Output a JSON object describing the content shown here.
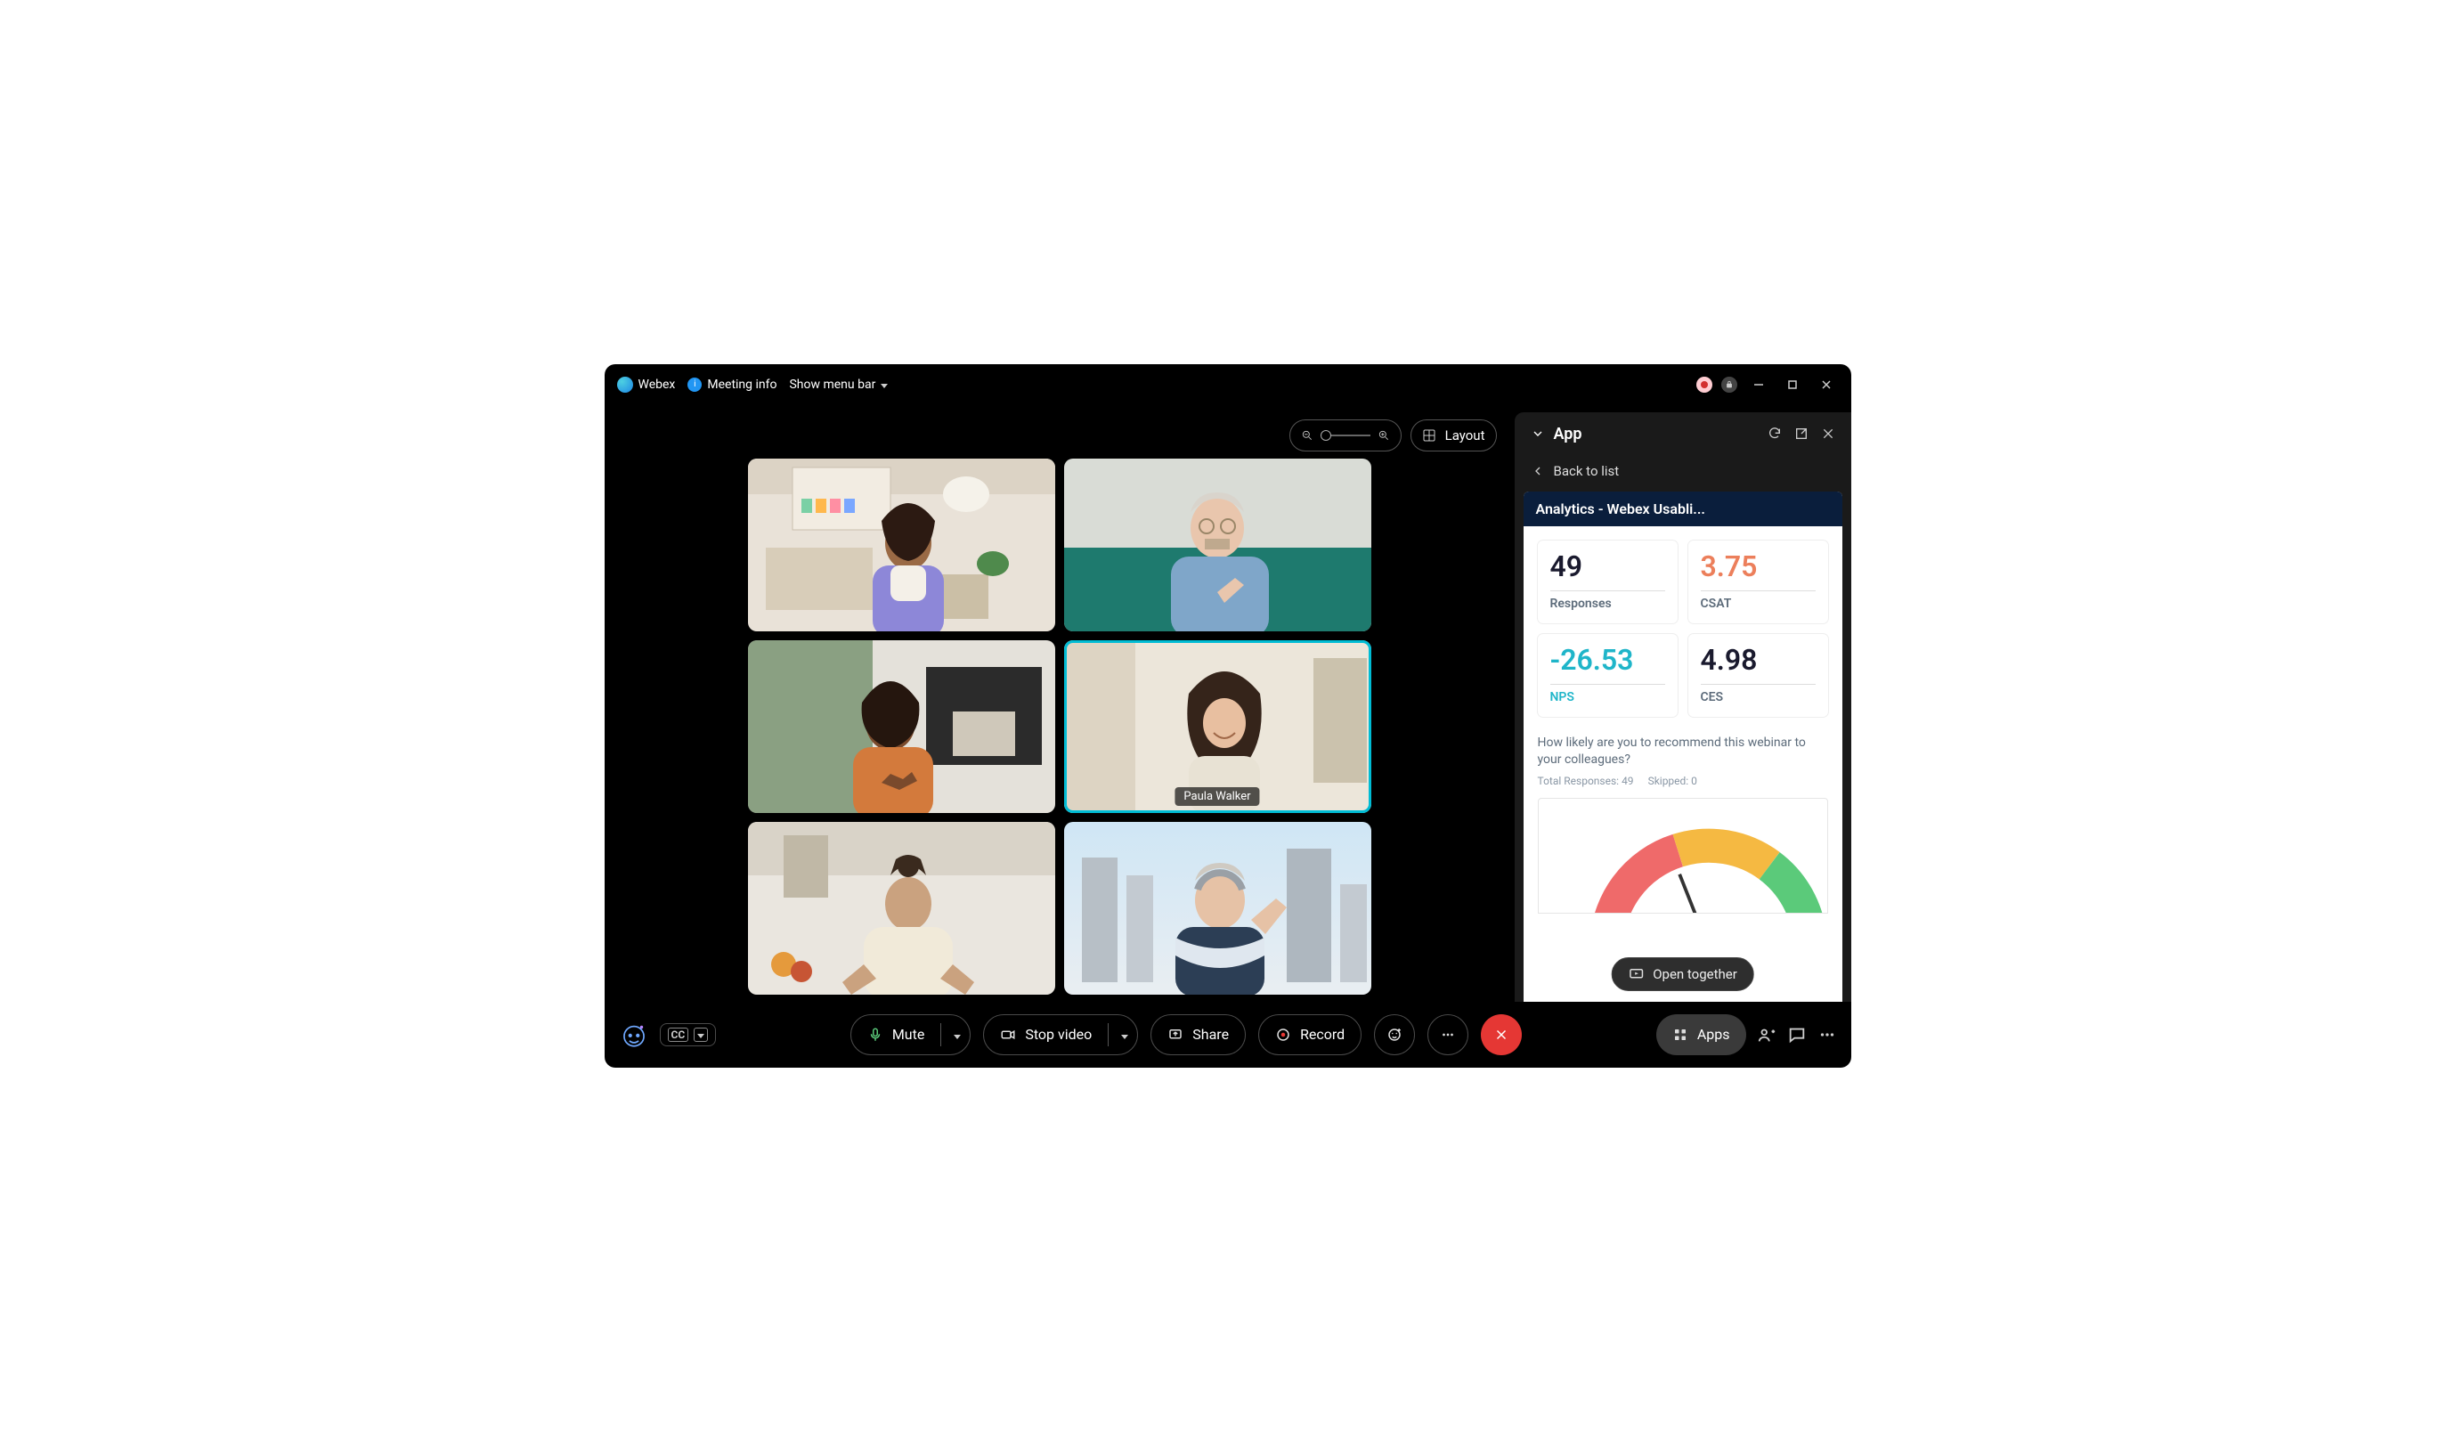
{
  "titlebar": {
    "brand": "Webex",
    "meeting_info": "Meeting info",
    "show_menu_bar": "Show menu bar"
  },
  "layout_control": {
    "layout_label": "Layout"
  },
  "participants": {
    "p4_name": "Paula Walker"
  },
  "panel": {
    "title": "App",
    "back": "Back to list",
    "app_title": "Analytics - Webex Usabli...",
    "open_together": "Open together"
  },
  "analytics": {
    "responses_value": "49",
    "responses_label": "Responses",
    "csat_value": "3.75",
    "csat_label": "CSAT",
    "nps_value": "-26.53",
    "nps_label": "NPS",
    "ces_value": "4.98",
    "ces_label": "CES",
    "question": "How likely are you to recommend this webinar to your colleagues?",
    "total_responses": "Total Responses: 49",
    "skipped": "Skipped: 0"
  },
  "toolbar": {
    "mute": "Mute",
    "stop_video": "Stop video",
    "share": "Share",
    "record": "Record",
    "apps": "Apps"
  }
}
